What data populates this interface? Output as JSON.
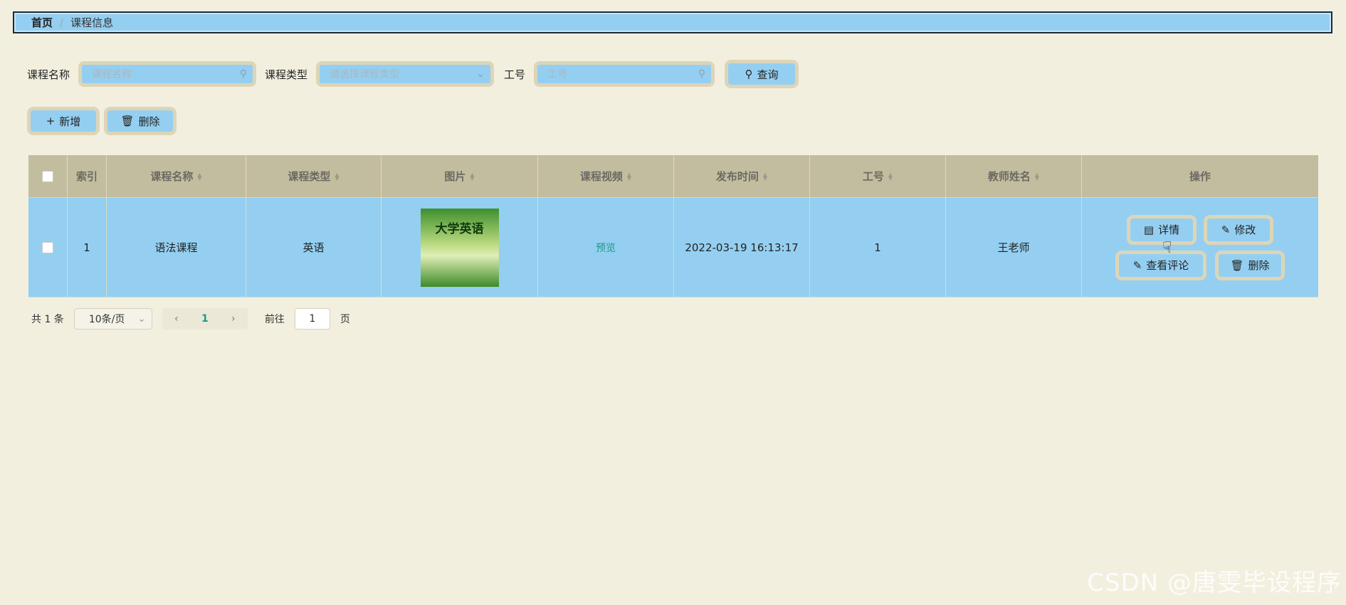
{
  "breadcrumb": {
    "home": "首页",
    "separator": "/",
    "current": "课程信息"
  },
  "search": {
    "course_name_label": "课程名称",
    "course_name_placeholder": "课程名称",
    "course_type_label": "课程类型",
    "course_type_placeholder": "请选择课程类型",
    "job_no_label": "工号",
    "job_no_placeholder": "工号",
    "query_label": "查询"
  },
  "toolbar": {
    "add_label": "新增",
    "delete_label": "删除"
  },
  "table": {
    "headers": [
      "索引",
      "课程名称",
      "课程类型",
      "图片",
      "课程视频",
      "发布时间",
      "工号",
      "教师姓名",
      "操作"
    ],
    "rows": [
      {
        "index": "1",
        "course_name": "语法课程",
        "course_type": "英语",
        "image_title": "大学英语",
        "video": "预览",
        "publish_time": "2022-03-19 16:13:17",
        "job_no": "1",
        "teacher": "王老师",
        "actions": {
          "detail": "详情",
          "edit": "修改",
          "comments": "查看评论",
          "delete": "删除"
        }
      }
    ]
  },
  "pager": {
    "total_text": "共 1 条",
    "page_size": "10条/页",
    "current_page": "1",
    "goto_label": "前往",
    "goto_value": "1",
    "page_suffix": "页"
  },
  "watermark": "CSDN @唐雯毕设程序",
  "colors": {
    "accent": "#94cff1",
    "background": "#f2efdf",
    "header": "#c3bd9f",
    "border": "#dcd5b8"
  }
}
